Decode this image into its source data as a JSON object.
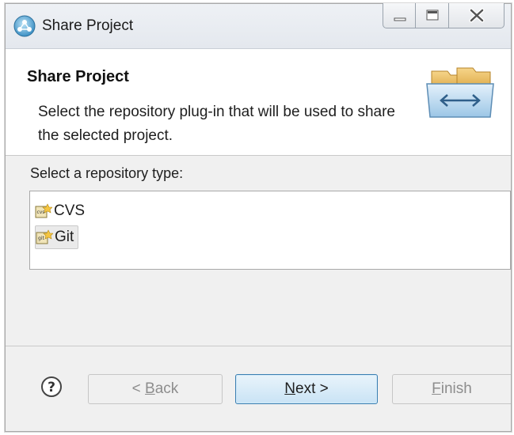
{
  "window": {
    "title": "Share Project",
    "icon": "eclipse-share-icon",
    "controls": [
      "minimize-icon",
      "maximize-icon",
      "close-icon"
    ]
  },
  "header": {
    "title": "Share Project",
    "description": "Select the repository plug-in that will be used to share the selected project.",
    "banner_icon": "folders-exchange-icon"
  },
  "body": {
    "select_label": "Select a repository type:",
    "repositories": [
      {
        "label": "CVS",
        "icon": "cvs-repository-icon",
        "selected": false
      },
      {
        "label": "Git",
        "icon": "git-repository-icon",
        "selected": true
      }
    ]
  },
  "footer": {
    "help_icon": "help-icon",
    "back": {
      "pre": "< ",
      "mnemonic": "B",
      "post": "ack",
      "enabled": false
    },
    "next": {
      "pre": "",
      "mnemonic": "N",
      "post": "ext >",
      "enabled": true,
      "default": true
    },
    "finish": {
      "pre": "",
      "mnemonic": "F",
      "post": "inish",
      "enabled": false
    }
  },
  "colors": {
    "dialog_bg": "#f0f0f0",
    "header_bg": "#ffffff",
    "default_button_border": "#3c7fb1",
    "disabled_text": "#8d8d8d"
  }
}
